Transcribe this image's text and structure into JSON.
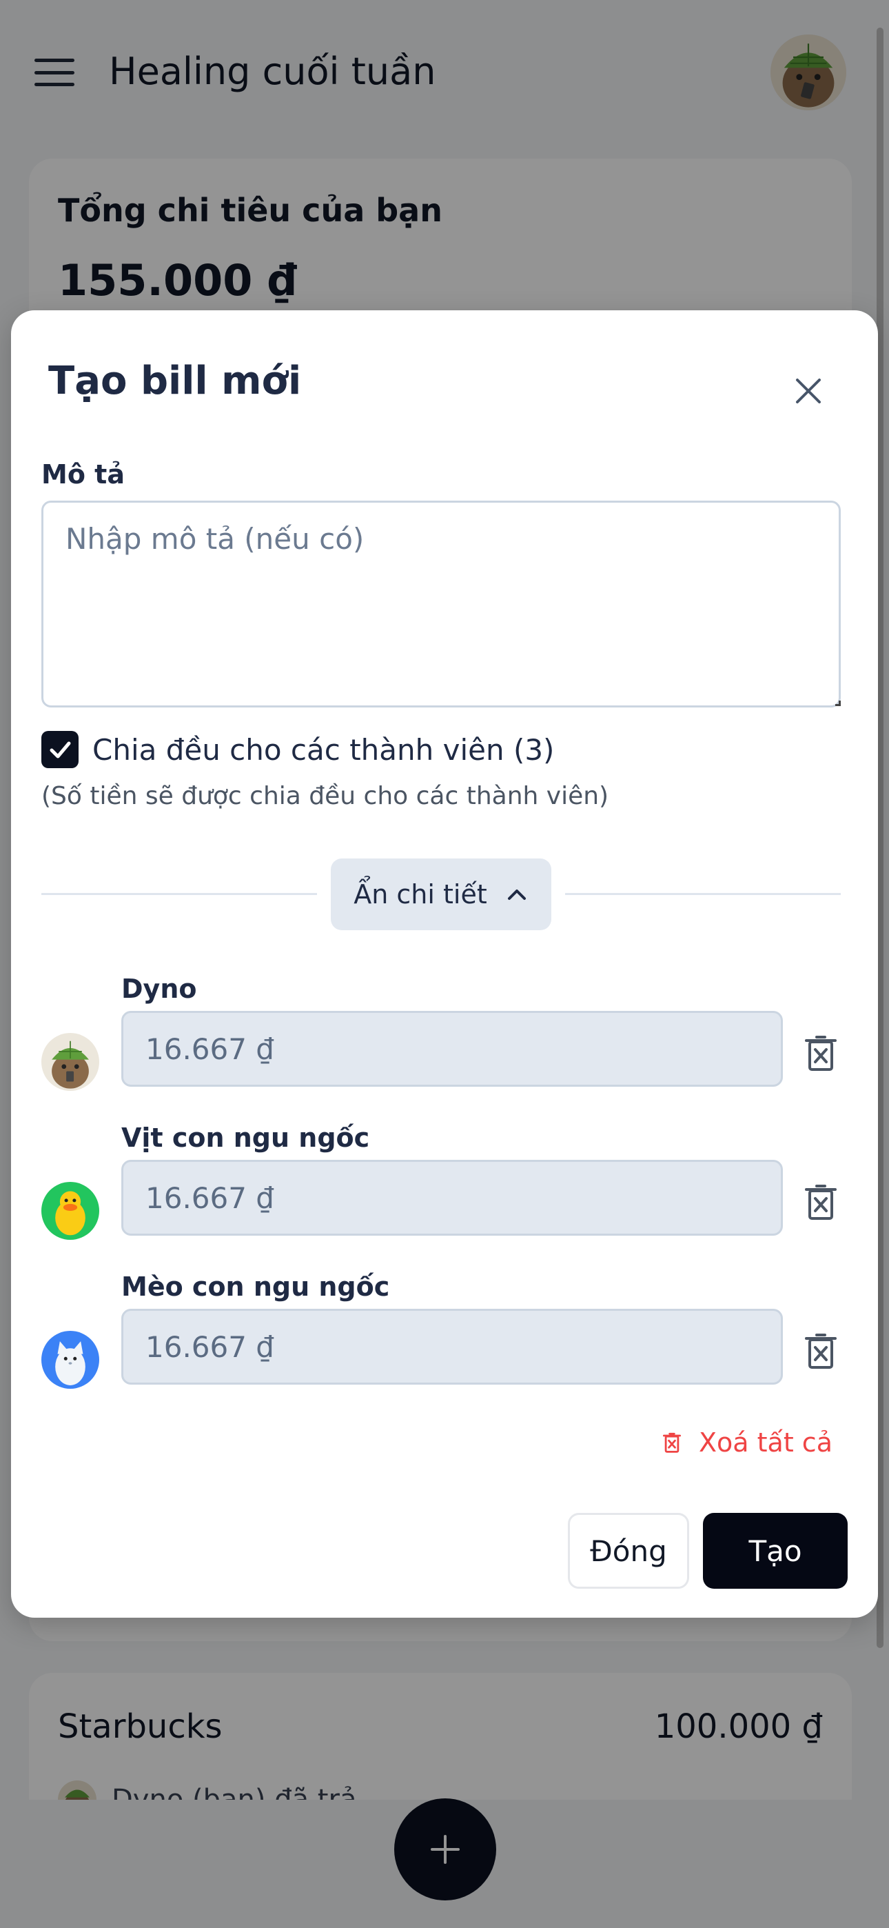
{
  "header": {
    "title": "Healing cuối tuần",
    "menu_icon": "hamburger-icon",
    "avatar_icon": "capybara-avatar"
  },
  "summary": {
    "label": "Tổng chi tiêu của bạn",
    "value": "155.000 ₫"
  },
  "bill_list": [
    {
      "name": "Starbucks",
      "amount": "100.000 ₫",
      "payer_text": "Dyno (bạn) đã trả"
    }
  ],
  "fab": {
    "icon": "plus-icon"
  },
  "modal": {
    "title": "Tạo bill mới",
    "close_icon": "close-icon",
    "description": {
      "label": "Mô tả",
      "placeholder": "Nhập mô tả (nếu có)",
      "value": ""
    },
    "split_equally": {
      "checked": true,
      "label": "Chia đều cho các thành viên (3)",
      "hint": "(Số tiền sẽ được chia đều cho các thành viên)"
    },
    "toggle_details": {
      "label": "Ẩn chi tiết",
      "icon": "chevron-up-icon"
    },
    "members": [
      {
        "name": "Dyno",
        "amount": "16.667 ₫",
        "avatar": "capybara-avatar"
      },
      {
        "name": "Vịt con ngu ngốc",
        "amount": "16.667 ₫",
        "avatar": "duck-avatar"
      },
      {
        "name": "Mèo con ngu ngốc",
        "amount": "16.667 ₫",
        "avatar": "cat-avatar"
      }
    ],
    "clear_all": {
      "label": "Xoá tất cả",
      "icon": "trash-x-icon"
    },
    "buttons": {
      "close_label": "Đóng",
      "create_label": "Tạo"
    }
  },
  "colors": {
    "primary": "#050814",
    "danger": "#ef4444",
    "input_bg": "#e2e8f0",
    "text": "#1f2a44"
  }
}
